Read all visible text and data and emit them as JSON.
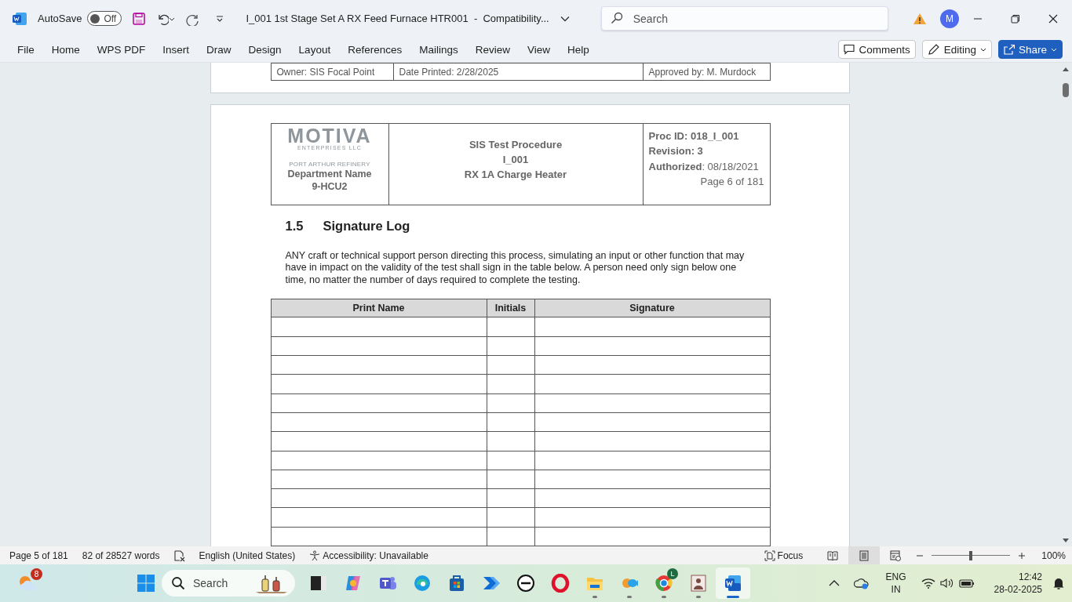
{
  "title_bar": {
    "autosave_label": "AutoSave",
    "autosave": {
      "on": false,
      "label": "Off"
    },
    "document_title": "I_001 1st Stage Set A RX Feed Furnace HTR001  -  Compatibility...",
    "search": {
      "placeholder": "Search"
    },
    "account_initial": "M"
  },
  "ribbon_tabs": [
    "File",
    "Home",
    "WPS PDF",
    "Insert",
    "Draw",
    "Design",
    "Layout",
    "References",
    "Mailings",
    "Review",
    "View",
    "Help"
  ],
  "ribbon_buttons": {
    "comments": "Comments",
    "editing": "Editing",
    "share": "Share"
  },
  "previous_page_footer": [
    "Owner: SIS Focal Point",
    "Date Printed: 2/28/2025",
    "Approved by: M. Murdock"
  ],
  "page_header": {
    "logo": {
      "name": "MOTIVA",
      "subtitle": "ENTERPRISES LLC",
      "site": "PORT ARTHUR REFINERY"
    },
    "department": "Department Name",
    "unit": "9-HCU2",
    "title_lines": [
      "SIS Test Procedure",
      "I_001",
      "RX 1A Charge Heater"
    ],
    "info_lines": [
      {
        "kind": "bold",
        "text": "Proc ID: 018_I_001"
      },
      {
        "kind": "bold",
        "text": "Revision: 3"
      },
      {
        "kind": "plain",
        "text": "**Authorized**: 08/18/2021"
      },
      {
        "kind": "page",
        "text": "Page 6 of 181"
      }
    ]
  },
  "section": {
    "number": "1.5",
    "title": "Signature Log",
    "paragraph": "ANY craft or technical support person directing this process, simulating an input or other function that may have in impact on the validity of the test shall sign in the table below. A person need only sign below one time, no matter the number of days required to complete the testing."
  },
  "signature_table": {
    "columns": [
      "Print Name",
      "Initials",
      "Signature"
    ],
    "rows": [
      {},
      {},
      {},
      {},
      {},
      {},
      {},
      {},
      {},
      {},
      {},
      {}
    ]
  },
  "status_bar": {
    "page": "Page 5 of 181",
    "words": "82 of 28527 words",
    "language": "English (United States)",
    "accessibility": "Accessibility: Unavailable",
    "focus": "Focus",
    "views": [
      {
        "kind": "read",
        "selected": false
      },
      {
        "kind": "print",
        "selected": true
      },
      {
        "kind": "web",
        "selected": false
      }
    ],
    "zoom": {
      "level": 0.5,
      "reading": "100%"
    }
  },
  "taskbar": {
    "weather_badge": "8",
    "search": {
      "placeholder": "Search"
    },
    "apps": [
      {
        "kind": "terminal",
        "running": false,
        "active": false
      },
      {
        "kind": "copilot",
        "running": false,
        "active": false
      },
      {
        "kind": "teams",
        "running": false,
        "active": false
      },
      {
        "kind": "edge",
        "running": false,
        "active": false
      },
      {
        "kind": "store",
        "running": false,
        "active": false
      },
      {
        "kind": "automate",
        "running": false,
        "active": false
      },
      {
        "kind": "dell",
        "running": false,
        "active": false
      },
      {
        "kind": "opera",
        "running": false,
        "active": false
      },
      {
        "kind": "folder",
        "running": true,
        "active": false
      },
      {
        "kind": "puzzle",
        "running": true,
        "active": false
      },
      {
        "kind": "chrome",
        "running": true,
        "active": false,
        "badge": "L"
      },
      {
        "kind": "portrait",
        "running": true,
        "active": false
      },
      {
        "kind": "word",
        "running": true,
        "active": true
      }
    ],
    "tray": {
      "language": "ENG",
      "region": "IN",
      "time": "12:42",
      "date": "28-02-2025"
    }
  }
}
